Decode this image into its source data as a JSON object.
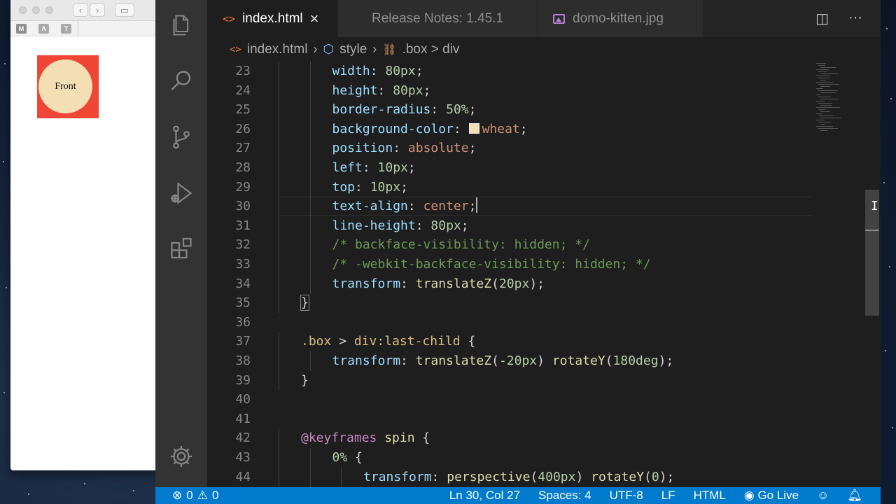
{
  "browser": {
    "bookmarks": [
      "M",
      "A",
      "T"
    ],
    "demo_label": "Front",
    "colors": {
      "box": "#ef4636",
      "front": "#f4deb3"
    }
  },
  "activity_bar": {
    "icons": [
      "files-icon",
      "search-icon",
      "source-control-icon",
      "run-debug-icon",
      "extensions-icon",
      "settings-gear-icon"
    ]
  },
  "tabs": [
    {
      "label": "index.html",
      "active": true,
      "icon": "html-icon"
    },
    {
      "label": "Release Notes: 1.45.1",
      "active": false
    },
    {
      "label": "domo-kitten.jpg",
      "active": false,
      "icon": "image-icon"
    }
  ],
  "breadcrumbs": {
    "file": "index.html",
    "section": "style",
    "selector": ".box > div"
  },
  "editor": {
    "lines": [
      {
        "n": "23",
        "parts": [
          [
            "prop",
            "width"
          ],
          [
            "punc",
            ": "
          ],
          [
            "num",
            "80px"
          ],
          [
            "punc",
            ";"
          ]
        ],
        "indent": 2
      },
      {
        "n": "24",
        "parts": [
          [
            "prop",
            "height"
          ],
          [
            "punc",
            ": "
          ],
          [
            "num",
            "80px"
          ],
          [
            "punc",
            ";"
          ]
        ],
        "indent": 2
      },
      {
        "n": "25",
        "parts": [
          [
            "prop",
            "border-radius"
          ],
          [
            "punc",
            ": "
          ],
          [
            "num",
            "50%"
          ],
          [
            "punc",
            ";"
          ]
        ],
        "indent": 2
      },
      {
        "n": "26",
        "parts": [
          [
            "prop",
            "background-color"
          ],
          [
            "punc",
            ": "
          ],
          [
            "swatch",
            ""
          ],
          [
            "str",
            "wheat"
          ],
          [
            "punc",
            ";"
          ]
        ],
        "indent": 2
      },
      {
        "n": "27",
        "parts": [
          [
            "prop",
            "position"
          ],
          [
            "punc",
            ": "
          ],
          [
            "str",
            "absolute"
          ],
          [
            "punc",
            ";"
          ]
        ],
        "indent": 2
      },
      {
        "n": "28",
        "parts": [
          [
            "prop",
            "left"
          ],
          [
            "punc",
            ": "
          ],
          [
            "num",
            "10px"
          ],
          [
            "punc",
            ";"
          ]
        ],
        "indent": 2
      },
      {
        "n": "29",
        "parts": [
          [
            "prop",
            "top"
          ],
          [
            "punc",
            ": "
          ],
          [
            "num",
            "10px"
          ],
          [
            "punc",
            ";"
          ]
        ],
        "indent": 2
      },
      {
        "n": "30",
        "parts": [
          [
            "prop",
            "text-align"
          ],
          [
            "punc",
            ": "
          ],
          [
            "str",
            "center"
          ],
          [
            "punc",
            ";"
          ],
          [
            "caret",
            ""
          ]
        ],
        "indent": 2
      },
      {
        "n": "31",
        "parts": [
          [
            "prop",
            "line-height"
          ],
          [
            "punc",
            ": "
          ],
          [
            "num",
            "80px"
          ],
          [
            "punc",
            ";"
          ]
        ],
        "indent": 2
      },
      {
        "n": "32",
        "parts": [
          [
            "com",
            "/* backface-visibility: hidden; */"
          ]
        ],
        "indent": 2
      },
      {
        "n": "33",
        "parts": [
          [
            "com",
            "/* -webkit-backface-visibility: hidden; */"
          ]
        ],
        "indent": 2
      },
      {
        "n": "34",
        "parts": [
          [
            "prop",
            "transform"
          ],
          [
            "punc",
            ": "
          ],
          [
            "fn",
            "translateZ"
          ],
          [
            "punc",
            "("
          ],
          [
            "num",
            "20px"
          ],
          [
            "punc",
            ");"
          ]
        ],
        "indent": 2
      },
      {
        "n": "35",
        "parts": [
          [
            "bracehl",
            "}"
          ]
        ],
        "indent": 1
      },
      {
        "n": "36",
        "parts": [],
        "indent": 0
      },
      {
        "n": "37",
        "parts": [
          [
            "sel",
            ".box"
          ],
          [
            "punc",
            " > "
          ],
          [
            "tag",
            "div"
          ],
          [
            "sel",
            ":last-child"
          ],
          [
            "punc",
            " {"
          ]
        ],
        "indent": 1
      },
      {
        "n": "38",
        "parts": [
          [
            "prop",
            "transform"
          ],
          [
            "punc",
            ": "
          ],
          [
            "fn",
            "translateZ"
          ],
          [
            "punc",
            "("
          ],
          [
            "num",
            "-20px"
          ],
          [
            "punc",
            ") "
          ],
          [
            "fn",
            "rotateY"
          ],
          [
            "punc",
            "("
          ],
          [
            "num",
            "180deg"
          ],
          [
            "punc",
            ");"
          ]
        ],
        "indent": 2
      },
      {
        "n": "39",
        "parts": [
          [
            "punc",
            "}"
          ]
        ],
        "indent": 1
      },
      {
        "n": "40",
        "parts": [],
        "indent": 0
      },
      {
        "n": "41",
        "parts": [],
        "indent": 0
      },
      {
        "n": "42",
        "parts": [
          [
            "kw",
            "@keyframes"
          ],
          [
            "punc",
            " "
          ],
          [
            "fn",
            "spin"
          ],
          [
            "punc",
            " {"
          ]
        ],
        "indent": 1
      },
      {
        "n": "43",
        "parts": [
          [
            "num",
            "0%"
          ],
          [
            "punc",
            " {"
          ]
        ],
        "indent": 2
      },
      {
        "n": "44",
        "parts": [
          [
            "prop",
            "transform"
          ],
          [
            "punc",
            ": "
          ],
          [
            "fn",
            "perspective"
          ],
          [
            "punc",
            "("
          ],
          [
            "num",
            "400px"
          ],
          [
            "punc",
            ") "
          ],
          [
            "fn",
            "rotateY"
          ],
          [
            "punc",
            "("
          ],
          [
            "num",
            "0"
          ],
          [
            "punc",
            ");"
          ]
        ],
        "indent": 3
      }
    ],
    "current_line": "30"
  },
  "statusbar": {
    "errors": "0",
    "warnings": "0",
    "position": "Ln 30, Col 27",
    "spaces": "Spaces: 4",
    "encoding": "UTF-8",
    "eol": "LF",
    "language": "HTML",
    "golive": "Go Live"
  },
  "colors": {
    "accent": "#007acc",
    "editor_bg": "#1e1e1e",
    "activity_bg": "#333333"
  }
}
